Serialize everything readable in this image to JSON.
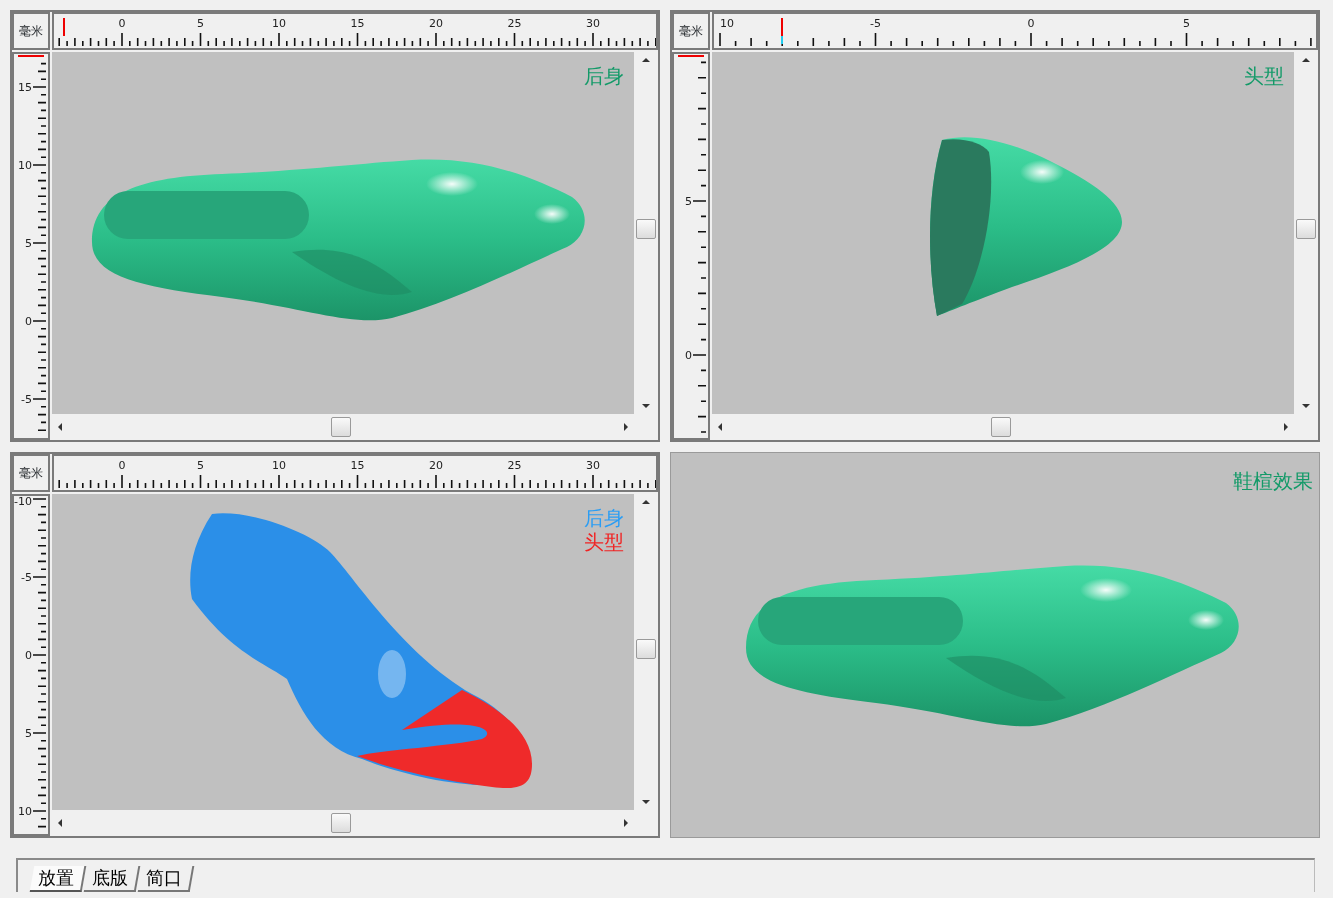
{
  "viewports": [
    {
      "kind": "ruled",
      "unit": "毫米",
      "h_ruler": [
        "0",
        "5",
        "10",
        "15",
        "20",
        "25",
        "30"
      ],
      "v_ruler": [
        "15",
        "10",
        "5",
        "0",
        "-5"
      ],
      "legend": [
        {
          "text": "后身",
          "color": "#139a68"
        }
      ]
    },
    {
      "kind": "ruled",
      "unit": "毫米",
      "h_ruler": [
        "10",
        "-5",
        "0",
        "5"
      ],
      "v_ruler": [
        "5",
        "0"
      ],
      "legend": [
        {
          "text": "头型",
          "color": "#139a68"
        }
      ]
    },
    {
      "kind": "ruled",
      "unit": "毫米",
      "h_ruler": [
        "0",
        "5",
        "10",
        "15",
        "20",
        "25",
        "30"
      ],
      "v_ruler": [
        "-10",
        "-5",
        "0",
        "5",
        "10"
      ],
      "legend": [
        {
          "text": "后身",
          "color": "#2a9df4"
        },
        {
          "text": "头型",
          "color": "#f02424"
        }
      ]
    },
    {
      "kind": "plain",
      "legend": [
        {
          "text": "鞋楦效果",
          "color": "#139a68"
        }
      ]
    }
  ],
  "tabs": [
    {
      "label": "放置",
      "selected": true
    },
    {
      "label": "底版",
      "selected": false
    },
    {
      "label": "简口",
      "selected": false
    }
  ]
}
